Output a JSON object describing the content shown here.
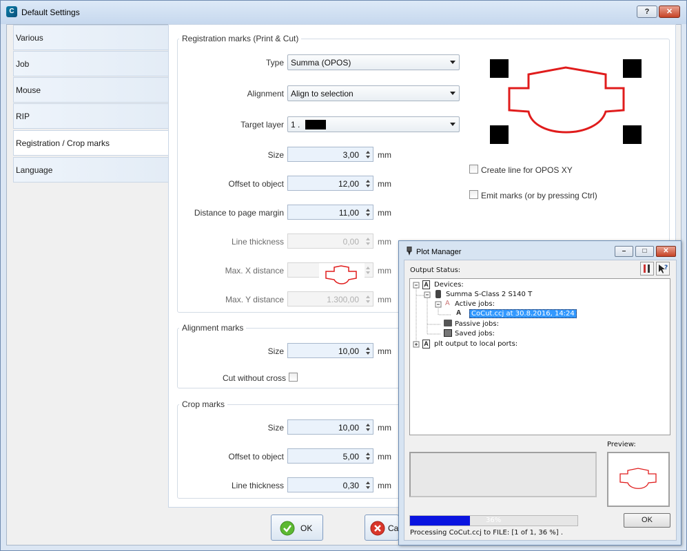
{
  "window": {
    "title": "Default Settings",
    "help": "?",
    "close": "✕"
  },
  "tabs": [
    "Various",
    "Job",
    "Mouse",
    "RIP",
    "Registration / Crop marks",
    "Language"
  ],
  "registration": {
    "group_title": "Registration marks (Print & Cut)",
    "type_label": "Type",
    "type_value": "Summa (OPOS)",
    "alignment_label": "Alignment",
    "alignment_value": "Align to selection",
    "target_layer_label": "Target layer",
    "target_layer_value": "1 .",
    "size_label": "Size",
    "size_value": "3,00",
    "offset_label": "Offset to object",
    "offset_value": "12,00",
    "distance_label": "Distance to page margin",
    "distance_value": "11,00",
    "line_thickness_label": "Line thickness",
    "line_thickness_value": "0,00",
    "max_x_label": "Max. X distance",
    "max_x_value": "",
    "max_y_label": "Max. Y distance",
    "max_y_value": "1.300,00",
    "unit": "mm",
    "create_line_label": "Create line for OPOS XY",
    "emit_marks_label": "Emit marks (or by pressing Ctrl)",
    "create_line_checked": false,
    "emit_marks_checked": false
  },
  "alignment_marks": {
    "group_title": "Alignment marks",
    "size_label": "Size",
    "size_value": "10,00",
    "cut_without_cross_label": "Cut without cross",
    "unit": "mm"
  },
  "crop_marks": {
    "group_title": "Crop marks",
    "size_label": "Size",
    "size_value": "10,00",
    "offset_label": "Offset to object",
    "offset_value": "5,00",
    "line_thickness_label": "Line thickness",
    "line_thickness_value": "0,30",
    "unit": "mm"
  },
  "buttons": {
    "ok": "OK",
    "cancel": "Ca"
  },
  "plot_manager": {
    "title": "Plot Manager",
    "output_status_label": "Output Status:",
    "tree": {
      "devices": "Devices:",
      "device_name": "Summa S-Class 2 S140 T",
      "active_jobs": "Active jobs:",
      "job": "CoCut.ccj at 30.8.2016, 14:24",
      "passive_jobs": "Passive jobs:",
      "saved_jobs": "Saved jobs:",
      "plt_output": "plt output to local ports:"
    },
    "preview_label": "Preview:",
    "progress_percent": 36,
    "progress_text": "36%",
    "status_text": "Processing CoCut.ccj to FILE: [1 of 1, 36 %] .",
    "ok_label": "OK"
  },
  "colors": {
    "mark_outline": "#e01c1c",
    "progress": "#0a14e0",
    "selection": "#3399ff"
  }
}
